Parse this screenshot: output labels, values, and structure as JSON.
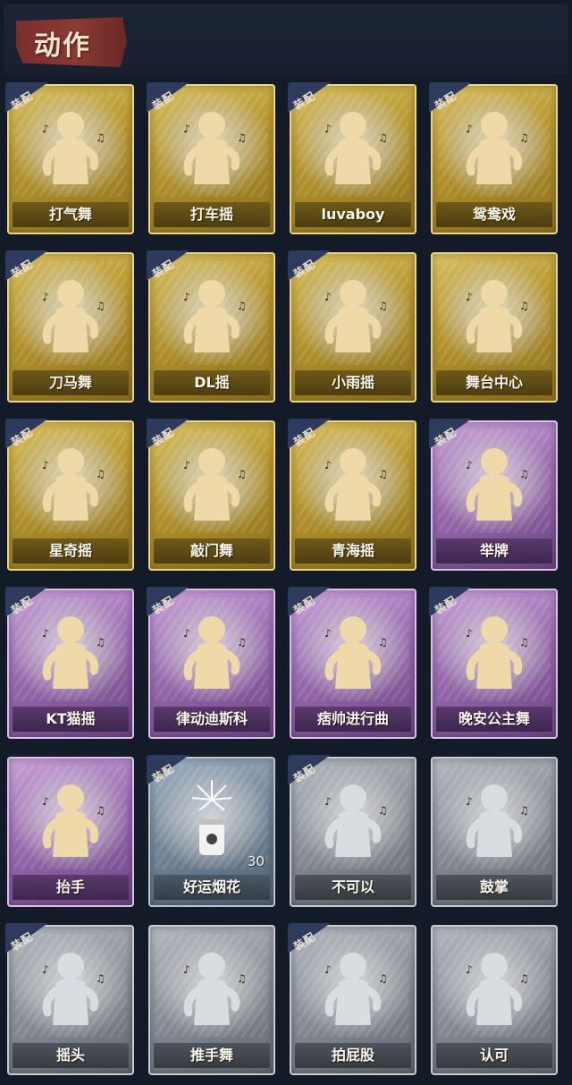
{
  "header": {
    "title": "动作"
  },
  "badge_text": "装配",
  "cards": [
    {
      "label": "打气舞",
      "tier": "gold",
      "equipped": true
    },
    {
      "label": "打车摇",
      "tier": "gold",
      "equipped": true
    },
    {
      "label": "luvaboy",
      "tier": "gold",
      "equipped": true
    },
    {
      "label": "鸳鸯戏",
      "tier": "gold",
      "equipped": true
    },
    {
      "label": "刀马舞",
      "tier": "gold",
      "equipped": true
    },
    {
      "label": "DL摇",
      "tier": "gold",
      "equipped": true
    },
    {
      "label": "小雨摇",
      "tier": "gold",
      "equipped": true
    },
    {
      "label": "舞台中心",
      "tier": "gold",
      "equipped": false
    },
    {
      "label": "星奇摇",
      "tier": "gold",
      "equipped": true
    },
    {
      "label": "敲门舞",
      "tier": "gold",
      "equipped": true
    },
    {
      "label": "青海摇",
      "tier": "gold",
      "equipped": true
    },
    {
      "label": "举牌",
      "tier": "purple",
      "equipped": true
    },
    {
      "label": "KT猫摇",
      "tier": "purple",
      "equipped": true
    },
    {
      "label": "律动迪斯科",
      "tier": "purple",
      "equipped": true
    },
    {
      "label": "痞帅进行曲",
      "tier": "purple",
      "equipped": true
    },
    {
      "label": "晚安公主舞",
      "tier": "purple",
      "equipped": true
    },
    {
      "label": "抬手",
      "tier": "purple",
      "equipped": false
    },
    {
      "label": "好运烟花",
      "tier": "slate",
      "equipped": true,
      "count": "30",
      "icon": "firework-icon"
    },
    {
      "label": "不可以",
      "tier": "grey",
      "equipped": true
    },
    {
      "label": "鼓掌",
      "tier": "grey",
      "equipped": false
    },
    {
      "label": "摇头",
      "tier": "grey",
      "equipped": true
    },
    {
      "label": "推手舞",
      "tier": "grey",
      "equipped": false
    },
    {
      "label": "拍屁股",
      "tier": "grey",
      "equipped": true
    },
    {
      "label": "认可",
      "tier": "grey",
      "equipped": false
    }
  ]
}
